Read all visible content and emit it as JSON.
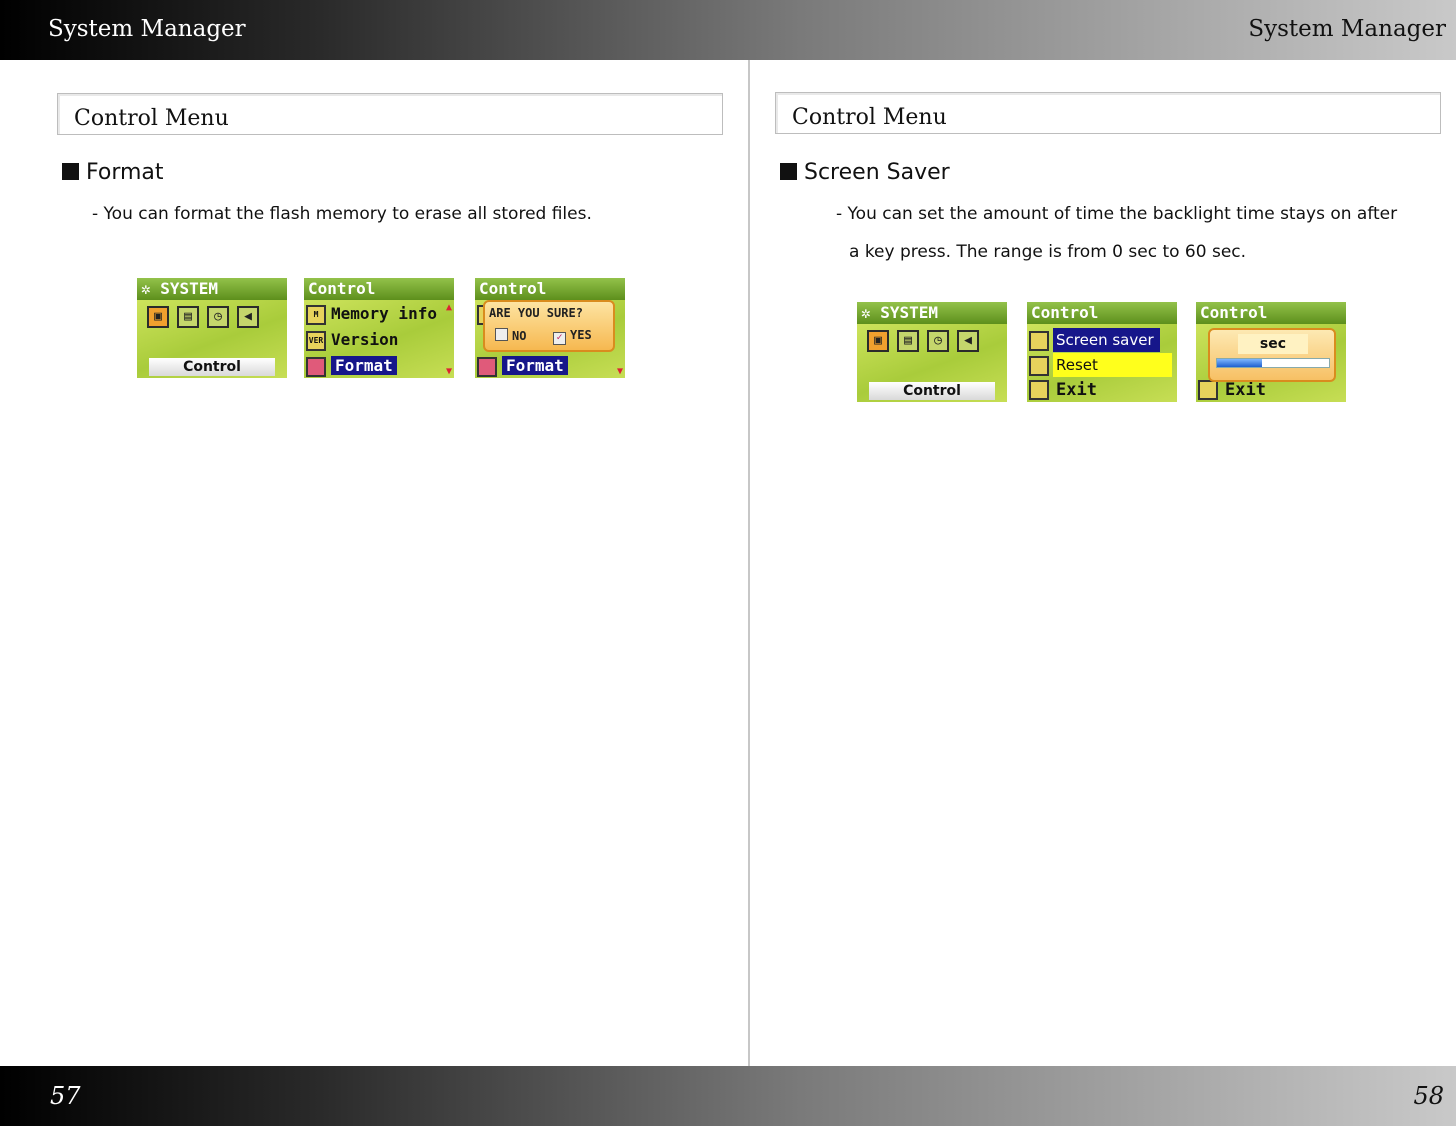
{
  "header": {
    "left_title": "System Manager",
    "right_title": "System Manager"
  },
  "footer": {
    "left_page": "57",
    "right_page": "58"
  },
  "left_page": {
    "section_title": "Control Menu",
    "heading": "Format",
    "description": "- You can format the flash memory to erase all stored files.",
    "screens": {
      "system": {
        "header": "SYSTEM",
        "control_label": "Control",
        "icons": [
          "control-icon",
          "display-icon",
          "clock-icon",
          "exit-icon"
        ]
      },
      "menu": {
        "header": "Control",
        "items": [
          "Memory info",
          "Version",
          "Format"
        ],
        "selected": "Format"
      },
      "confirm": {
        "header": "Control",
        "title": "ARE YOU SURE?",
        "option_no": "NO",
        "option_yes": "YES",
        "checked": "YES",
        "selected_row": "Format"
      }
    }
  },
  "right_page": {
    "section_title": "Control Menu",
    "heading": "Screen Saver",
    "description_line1": "- You can set the amount of time the backlight time stays on after",
    "description_line2": "a key press. The range is from 0 sec to 60 sec.",
    "screens": {
      "system": {
        "header": "SYSTEM",
        "control_label": "Control"
      },
      "menu": {
        "header": "Control",
        "items": [
          "Screen saver",
          "Reset",
          "Exit"
        ],
        "selected": "Screen saver"
      },
      "slider": {
        "header": "Control",
        "unit_label": "sec",
        "level_fraction": 0.4,
        "background_row": "Exit"
      }
    }
  },
  "colors": {
    "highlight": "#16168a",
    "screen_green": "#c7de55",
    "dialog_orange": "#f6b850"
  }
}
